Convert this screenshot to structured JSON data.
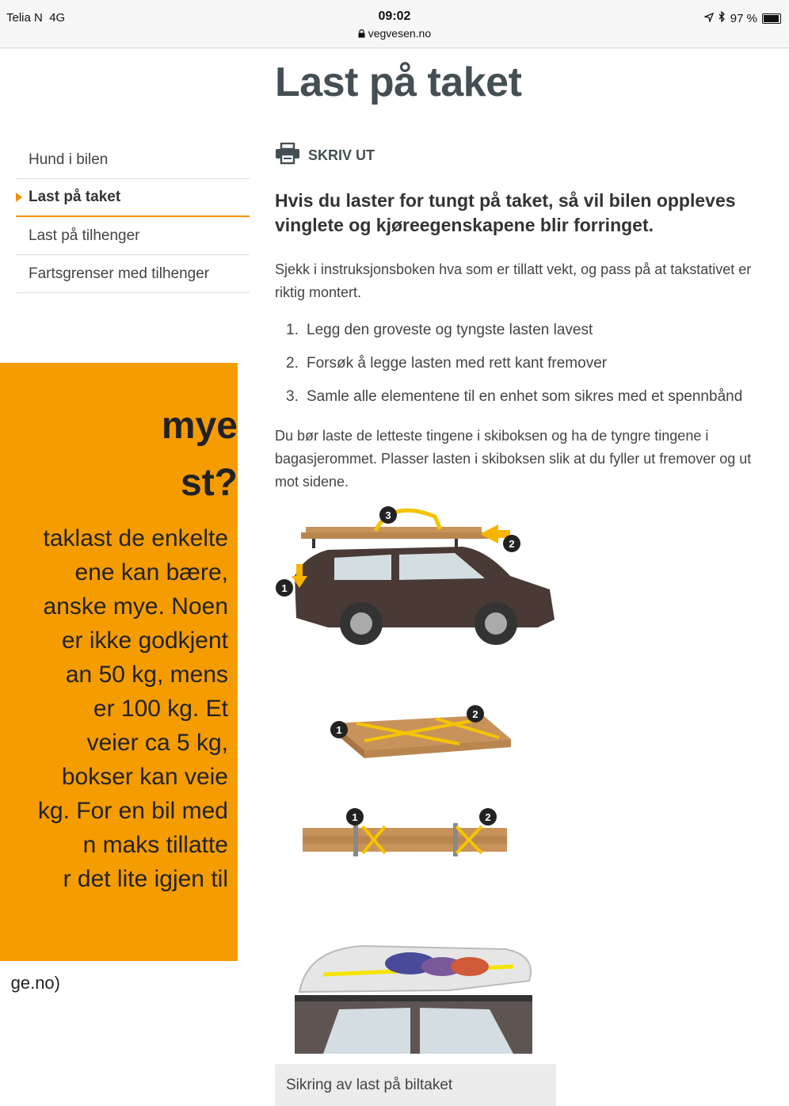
{
  "status_bar": {
    "carrier": "Telia N",
    "network": "4G",
    "time": "09:02",
    "url": "vegvesen.no",
    "battery": "97 %",
    "battery_level": 0.97
  },
  "page": {
    "title": "Last på taket"
  },
  "sidebar": {
    "items": [
      {
        "label": "Hund i bilen"
      },
      {
        "label": "Last på taket"
      },
      {
        "label": "Last på tilhenger"
      },
      {
        "label": "Fartsgrenser med tilhenger"
      }
    ],
    "active_index": 1
  },
  "print": {
    "label": "SKRIV UT",
    "icon": "printer-icon"
  },
  "article": {
    "lead": "Hvis du laster for tungt på taket, så vil bilen oppleves vinglete og kjøreegenskapene blir forringet.",
    "intro": "Sjekk i instruksjonsboken hva som er tillatt vekt, og pass på at takstativet er riktig montert.",
    "steps": [
      {
        "num": "1.",
        "text": "Legg den groveste og tyngste lasten lavest"
      },
      {
        "num": "2.",
        "text": "Forsøk å legge lasten med rett kant fremover"
      },
      {
        "num": "3.",
        "text": "Samle alle elementene til en enhet som sikres med et spennbånd"
      }
    ],
    "outro": "Du bør laste de letteste tingene i skiboksen og ha de tyngre tingene i bagasjerommet. Plasser lasten i skiboksen slik at du fyller ut fremover og ut mot sidene.",
    "figure_labels": {
      "one": "1",
      "two": "2",
      "three": "3"
    },
    "caption": "Sikring av last på biltaket"
  },
  "callout": {
    "title_line1": "mye",
    "title_line2": "st?",
    "body": "taklast de enkelte\nene kan bære,\nanske mye. Noen\ner ikke godkjent\nan 50 kg, mens\ner 100 kg. Et\nveier ca 5 kg,\nbokser kan veie\nkg. For en bil med\nn maks tillatte\nr det lite igjen til",
    "source": "ge.no)"
  },
  "colors": {
    "accent": "#f29200",
    "callout_bg": "#f59c00",
    "title": "#444f55",
    "car": "#4a3a36",
    "wood": "#c8935a",
    "strap": "#f5c400",
    "arrow": "#f7b500"
  }
}
